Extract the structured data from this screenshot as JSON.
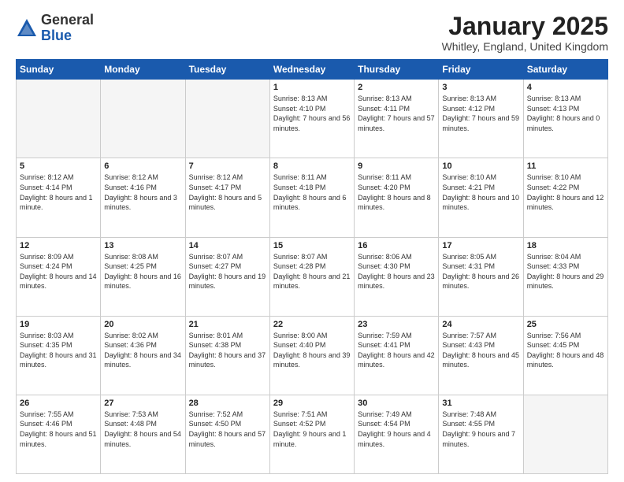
{
  "header": {
    "logo_general": "General",
    "logo_blue": "Blue",
    "title": "January 2025",
    "subtitle": "Whitley, England, United Kingdom"
  },
  "days_of_week": [
    "Sunday",
    "Monday",
    "Tuesday",
    "Wednesday",
    "Thursday",
    "Friday",
    "Saturday"
  ],
  "weeks": [
    [
      {
        "day": "",
        "info": ""
      },
      {
        "day": "",
        "info": ""
      },
      {
        "day": "",
        "info": ""
      },
      {
        "day": "1",
        "info": "Sunrise: 8:13 AM\nSunset: 4:10 PM\nDaylight: 7 hours and 56 minutes."
      },
      {
        "day": "2",
        "info": "Sunrise: 8:13 AM\nSunset: 4:11 PM\nDaylight: 7 hours and 57 minutes."
      },
      {
        "day": "3",
        "info": "Sunrise: 8:13 AM\nSunset: 4:12 PM\nDaylight: 7 hours and 59 minutes."
      },
      {
        "day": "4",
        "info": "Sunrise: 8:13 AM\nSunset: 4:13 PM\nDaylight: 8 hours and 0 minutes."
      }
    ],
    [
      {
        "day": "5",
        "info": "Sunrise: 8:12 AM\nSunset: 4:14 PM\nDaylight: 8 hours and 1 minute."
      },
      {
        "day": "6",
        "info": "Sunrise: 8:12 AM\nSunset: 4:16 PM\nDaylight: 8 hours and 3 minutes."
      },
      {
        "day": "7",
        "info": "Sunrise: 8:12 AM\nSunset: 4:17 PM\nDaylight: 8 hours and 5 minutes."
      },
      {
        "day": "8",
        "info": "Sunrise: 8:11 AM\nSunset: 4:18 PM\nDaylight: 8 hours and 6 minutes."
      },
      {
        "day": "9",
        "info": "Sunrise: 8:11 AM\nSunset: 4:20 PM\nDaylight: 8 hours and 8 minutes."
      },
      {
        "day": "10",
        "info": "Sunrise: 8:10 AM\nSunset: 4:21 PM\nDaylight: 8 hours and 10 minutes."
      },
      {
        "day": "11",
        "info": "Sunrise: 8:10 AM\nSunset: 4:22 PM\nDaylight: 8 hours and 12 minutes."
      }
    ],
    [
      {
        "day": "12",
        "info": "Sunrise: 8:09 AM\nSunset: 4:24 PM\nDaylight: 8 hours and 14 minutes."
      },
      {
        "day": "13",
        "info": "Sunrise: 8:08 AM\nSunset: 4:25 PM\nDaylight: 8 hours and 16 minutes."
      },
      {
        "day": "14",
        "info": "Sunrise: 8:07 AM\nSunset: 4:27 PM\nDaylight: 8 hours and 19 minutes."
      },
      {
        "day": "15",
        "info": "Sunrise: 8:07 AM\nSunset: 4:28 PM\nDaylight: 8 hours and 21 minutes."
      },
      {
        "day": "16",
        "info": "Sunrise: 8:06 AM\nSunset: 4:30 PM\nDaylight: 8 hours and 23 minutes."
      },
      {
        "day": "17",
        "info": "Sunrise: 8:05 AM\nSunset: 4:31 PM\nDaylight: 8 hours and 26 minutes."
      },
      {
        "day": "18",
        "info": "Sunrise: 8:04 AM\nSunset: 4:33 PM\nDaylight: 8 hours and 29 minutes."
      }
    ],
    [
      {
        "day": "19",
        "info": "Sunrise: 8:03 AM\nSunset: 4:35 PM\nDaylight: 8 hours and 31 minutes."
      },
      {
        "day": "20",
        "info": "Sunrise: 8:02 AM\nSunset: 4:36 PM\nDaylight: 8 hours and 34 minutes."
      },
      {
        "day": "21",
        "info": "Sunrise: 8:01 AM\nSunset: 4:38 PM\nDaylight: 8 hours and 37 minutes."
      },
      {
        "day": "22",
        "info": "Sunrise: 8:00 AM\nSunset: 4:40 PM\nDaylight: 8 hours and 39 minutes."
      },
      {
        "day": "23",
        "info": "Sunrise: 7:59 AM\nSunset: 4:41 PM\nDaylight: 8 hours and 42 minutes."
      },
      {
        "day": "24",
        "info": "Sunrise: 7:57 AM\nSunset: 4:43 PM\nDaylight: 8 hours and 45 minutes."
      },
      {
        "day": "25",
        "info": "Sunrise: 7:56 AM\nSunset: 4:45 PM\nDaylight: 8 hours and 48 minutes."
      }
    ],
    [
      {
        "day": "26",
        "info": "Sunrise: 7:55 AM\nSunset: 4:46 PM\nDaylight: 8 hours and 51 minutes."
      },
      {
        "day": "27",
        "info": "Sunrise: 7:53 AM\nSunset: 4:48 PM\nDaylight: 8 hours and 54 minutes."
      },
      {
        "day": "28",
        "info": "Sunrise: 7:52 AM\nSunset: 4:50 PM\nDaylight: 8 hours and 57 minutes."
      },
      {
        "day": "29",
        "info": "Sunrise: 7:51 AM\nSunset: 4:52 PM\nDaylight: 9 hours and 1 minute."
      },
      {
        "day": "30",
        "info": "Sunrise: 7:49 AM\nSunset: 4:54 PM\nDaylight: 9 hours and 4 minutes."
      },
      {
        "day": "31",
        "info": "Sunrise: 7:48 AM\nSunset: 4:55 PM\nDaylight: 9 hours and 7 minutes."
      },
      {
        "day": "",
        "info": ""
      }
    ]
  ]
}
